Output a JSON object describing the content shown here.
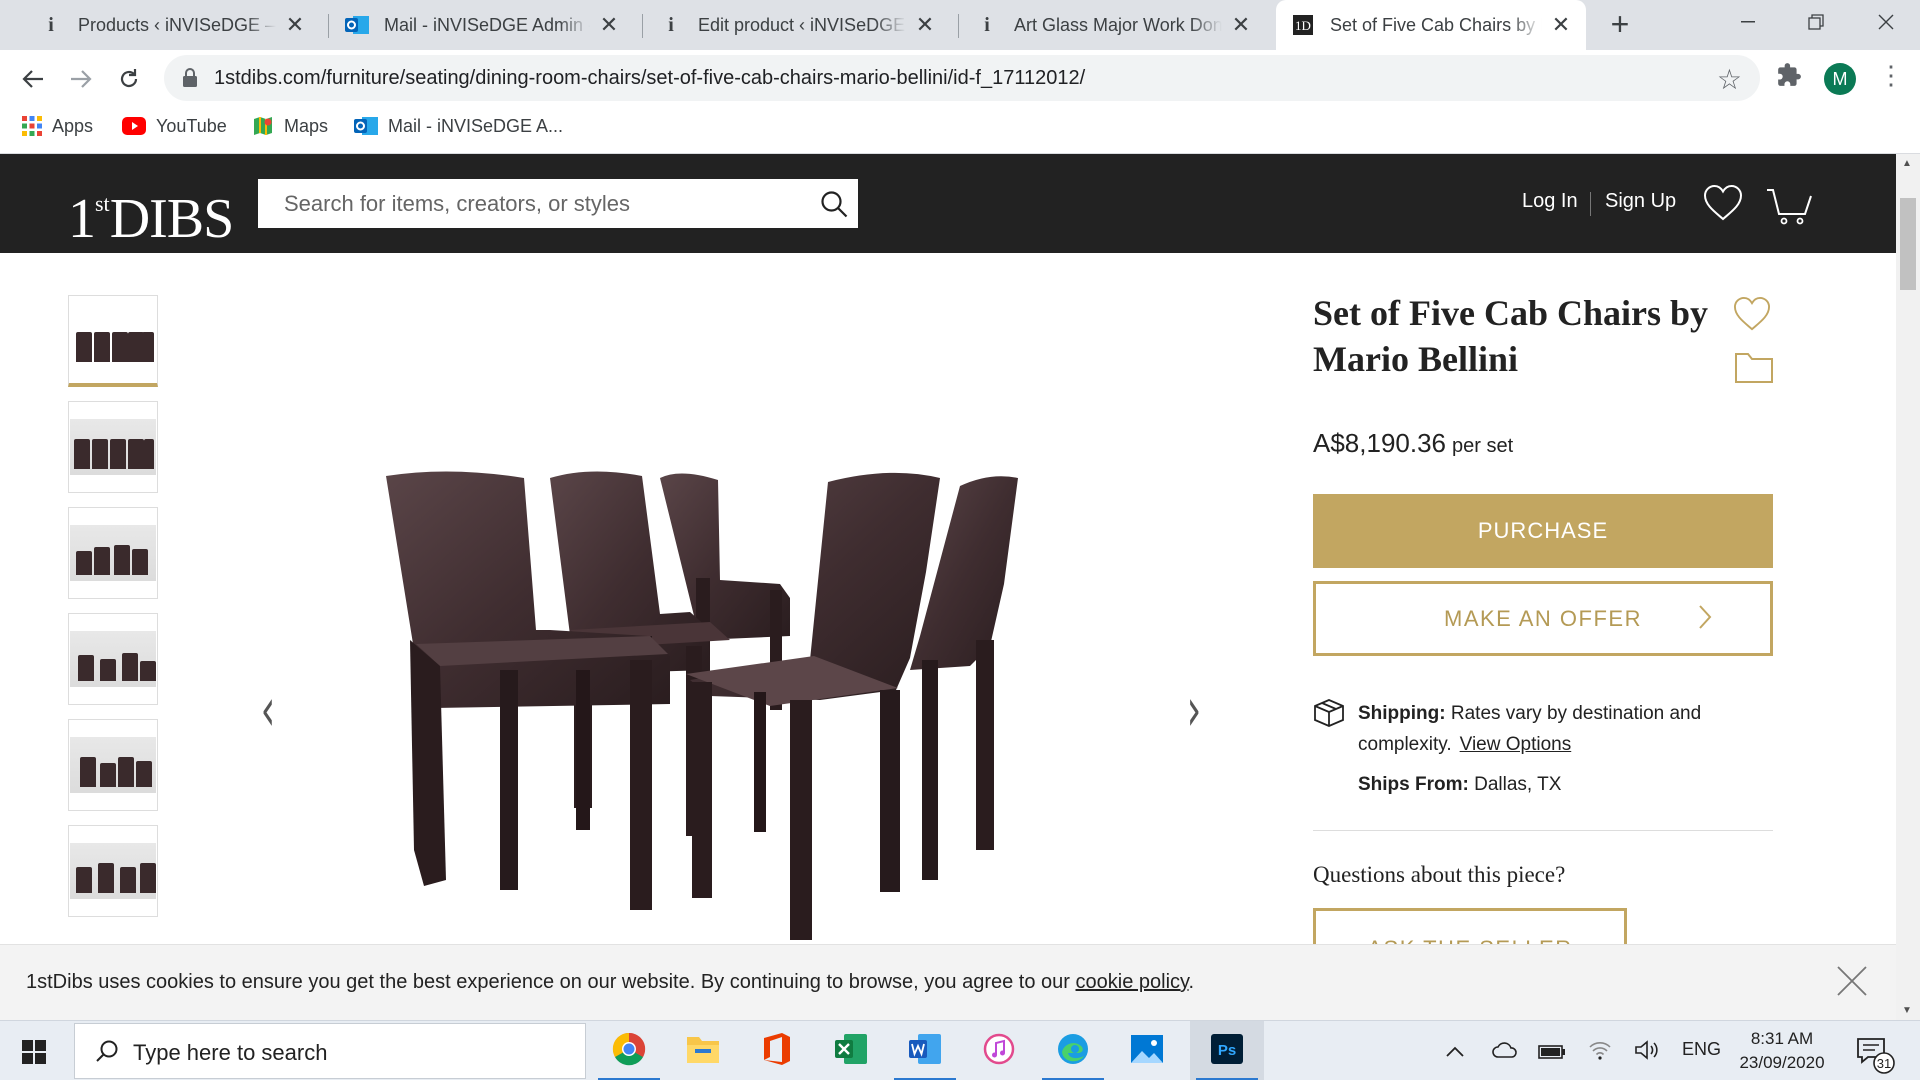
{
  "browser": {
    "tabs": [
      {
        "title": "Products ‹ iNVISeDGE — WordPress",
        "icon": "info-icon",
        "active": false
      },
      {
        "title": "Mail - iNVISeDGE Admin - Outlook",
        "icon": "outlook-icon",
        "active": false
      },
      {
        "title": "Edit product ‹ iNVISeDGE — WordPress",
        "icon": "info-icon",
        "active": false
      },
      {
        "title": "Art Glass Major Work Don Vogel",
        "icon": "info-icon",
        "active": false
      },
      {
        "title": "Set of Five Cab Chairs by Mario Bellini",
        "icon": "1stdibs-icon",
        "active": true
      }
    ],
    "url": "1stdibs.com/furniture/seating/dining-room-chairs/set-of-five-cab-chairs-mario-bellini/id-f_17112012/",
    "profile_initial": "M",
    "bookmarks": [
      {
        "label": "Apps",
        "icon": "apps-grid-icon"
      },
      {
        "label": "YouTube",
        "icon": "youtube-icon"
      },
      {
        "label": "Maps",
        "icon": "maps-icon"
      },
      {
        "label": "Mail - iNVISeDGE A...",
        "icon": "outlook-icon"
      }
    ]
  },
  "site": {
    "logo_main": "DIBS",
    "logo_prefix": "1",
    "logo_sup": "st",
    "search_placeholder": "Search for items, creators, or styles",
    "login_label": "Log In",
    "signup_label": "Sign Up"
  },
  "product": {
    "title": "Set of Five Cab Chairs by Mario Bellini",
    "price": "A$8,190.36",
    "price_unit": "per set",
    "purchase_label": "PURCHASE",
    "offer_label": "MAKE AN OFFER",
    "shipping_label": "Shipping:",
    "shipping_text": "Rates vary by destination and complexity.",
    "view_options_label": "View Options",
    "ships_from_label": "Ships From:",
    "ships_from_value": "Dallas, TX",
    "questions_heading": "Questions about this piece?",
    "ask_seller_label": "ASK THE SELLER",
    "thumbnail_count": 6
  },
  "cookie": {
    "message": "1stDibs uses cookies to ensure you get the best experience on our website. By continuing to browse, you agree to our",
    "link_label": "cookie policy",
    "suffix": "."
  },
  "taskbar": {
    "search_label": "Type here to search",
    "apps": [
      "chrome-icon",
      "file-explorer-icon",
      "office-icon",
      "excel-icon",
      "word-icon",
      "itunes-icon",
      "edge-icon",
      "photos-icon",
      "photoshop-icon"
    ],
    "language": "ENG",
    "time": "8:31 AM",
    "date": "23/09/2020",
    "notification_count": "31"
  },
  "colors": {
    "brand_gold": "#c2a661",
    "header_bg": "#222222",
    "chair_leather": "#3a2a2c"
  }
}
